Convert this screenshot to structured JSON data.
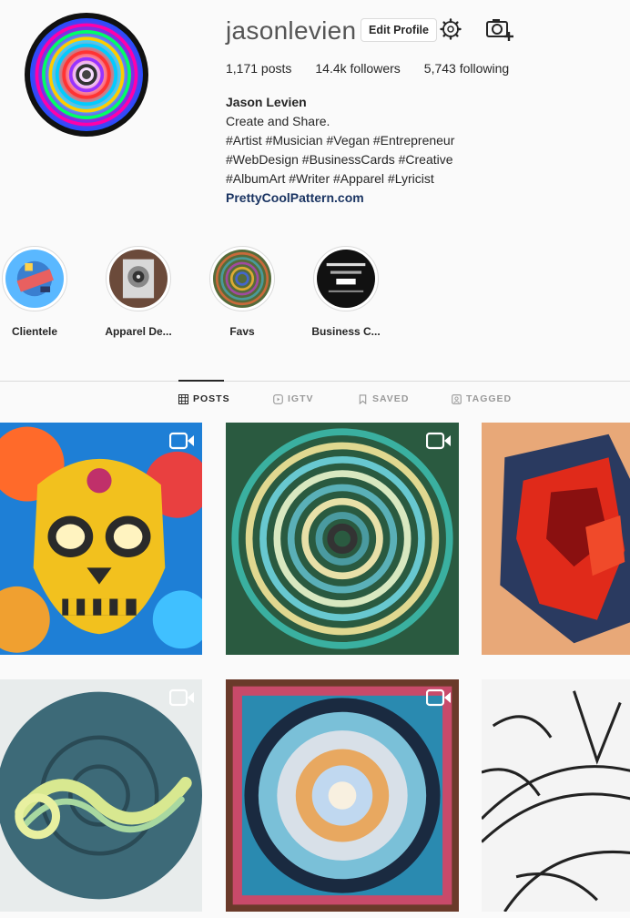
{
  "profile": {
    "username": "jasonlevien",
    "edit_label": "Edit Profile",
    "stats": {
      "posts": "1,171 posts",
      "followers": "14.4k followers",
      "following": "5,743 following"
    },
    "bio": {
      "name": "Jason Levien",
      "lines": [
        "Create and Share.",
        "#Artist #Musician #Vegan #Entrepreneur",
        "#WebDesign #BusinessCards #Creative",
        "#AlbumArt #Writer #Apparel #Lyricist"
      ],
      "link": "PrettyCoolPattern.com"
    }
  },
  "highlights": [
    {
      "label": "Clientele"
    },
    {
      "label": "Apparel De..."
    },
    {
      "label": "Favs"
    },
    {
      "label": "Business C..."
    }
  ],
  "tabs": [
    {
      "label": "POSTS",
      "icon": "grid-icon",
      "active": true
    },
    {
      "label": "IGTV",
      "icon": "igtv-icon",
      "active": false
    },
    {
      "label": "SAVED",
      "icon": "bookmark-icon",
      "active": false
    },
    {
      "label": "TAGGED",
      "icon": "tag-icon",
      "active": false
    }
  ],
  "posts": [
    {
      "subject": "sugar skull",
      "video": true
    },
    {
      "subject": "spiral mandala",
      "video": true
    },
    {
      "subject": "red abstract",
      "video": false
    },
    {
      "subject": "grow lettering",
      "video": true
    },
    {
      "subject": "circle mandala",
      "video": true
    },
    {
      "subject": "sketch",
      "video": false
    }
  ],
  "colors": {
    "text": "#262626",
    "muted": "#999999",
    "border": "#dbdbdb",
    "link": "#1a3462",
    "background": "#fafafa"
  }
}
